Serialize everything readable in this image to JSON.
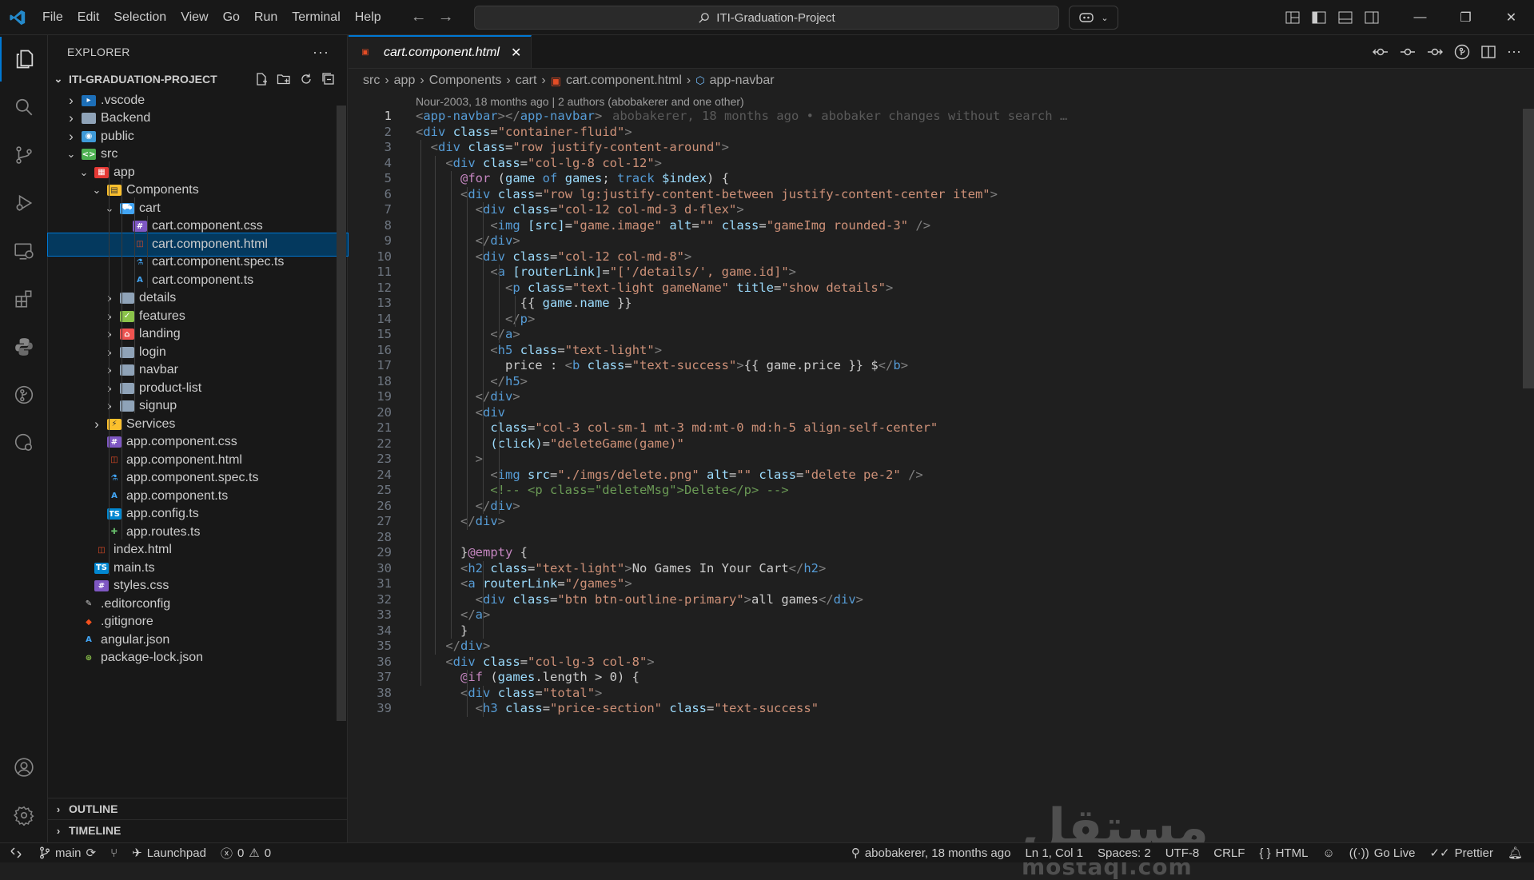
{
  "menu": [
    "File",
    "Edit",
    "Selection",
    "View",
    "Go",
    "Run",
    "Terminal",
    "Help"
  ],
  "command_center": "ITI-Graduation-Project",
  "explorer": {
    "title": "EXPLORER",
    "root": "ITI-GRADUATION-PROJECT",
    "items": [
      {
        "label": ".vscode",
        "icon": "vscode-folder-icon",
        "expanded": false
      },
      {
        "label": "Backend",
        "icon": "folder-icon",
        "expanded": false
      },
      {
        "label": "public",
        "icon": "public-folder-icon",
        "expanded": false
      },
      {
        "label": "src",
        "icon": "src-folder-icon",
        "expanded": true
      },
      {
        "label": "app",
        "icon": "app-folder-icon",
        "expanded": true
      },
      {
        "label": "Components",
        "icon": "components-folder-icon",
        "expanded": true
      },
      {
        "label": "cart",
        "icon": "cart-folder-icon",
        "expanded": true
      },
      {
        "label": "cart.component.css",
        "icon": "css-file-icon"
      },
      {
        "label": "cart.component.html",
        "icon": "html-file-icon",
        "selected": true
      },
      {
        "label": "cart.component.spec.ts",
        "icon": "test-file-icon"
      },
      {
        "label": "cart.component.ts",
        "icon": "angular-file-icon"
      },
      {
        "label": "details",
        "icon": "folder-icon",
        "expanded": false
      },
      {
        "label": "features",
        "icon": "features-folder-icon",
        "expanded": false
      },
      {
        "label": "landing",
        "icon": "landing-folder-icon",
        "expanded": false
      },
      {
        "label": "login",
        "icon": "folder-icon",
        "expanded": false
      },
      {
        "label": "navbar",
        "icon": "folder-icon",
        "expanded": false
      },
      {
        "label": "product-list",
        "icon": "folder-icon",
        "expanded": false
      },
      {
        "label": "signup",
        "icon": "folder-icon",
        "expanded": false
      },
      {
        "label": "Services",
        "icon": "services-folder-icon",
        "expanded": false
      },
      {
        "label": "app.component.css",
        "icon": "css-file-icon"
      },
      {
        "label": "app.component.html",
        "icon": "html-file-icon"
      },
      {
        "label": "app.component.spec.ts",
        "icon": "test-file-icon"
      },
      {
        "label": "app.component.ts",
        "icon": "angular-file-icon"
      },
      {
        "label": "app.config.ts",
        "icon": "ts-file-icon"
      },
      {
        "label": "app.routes.ts",
        "icon": "routes-file-icon"
      },
      {
        "label": "index.html",
        "icon": "html-file-icon"
      },
      {
        "label": "main.ts",
        "icon": "ts-file-icon"
      },
      {
        "label": "styles.css",
        "icon": "css-file-icon"
      },
      {
        "label": ".editorconfig",
        "icon": "editorconfig-icon"
      },
      {
        "label": ".gitignore",
        "icon": "git-icon"
      },
      {
        "label": "angular.json",
        "icon": "angular-file-icon"
      },
      {
        "label": "package-lock.json",
        "icon": "npm-file-icon"
      }
    ],
    "outline": "OUTLINE",
    "timeline": "TIMELINE"
  },
  "tab": {
    "label": "cart.component.html"
  },
  "breadcrumb": [
    "src",
    "app",
    "Components",
    "cart",
    "cart.component.html",
    "app-navbar"
  ],
  "blame_header": "Nour-2003, 18 months ago | 2 authors (abobakerer and one other)",
  "inline_blame": "abobakerer, 18 months ago • abobaker changes without search …",
  "code_lines": [
    "<app-navbar></app-navbar>",
    "<div class=\"container-fluid\">",
    "  <div class=\"row justify-content-around\">",
    "    <div class=\"col-lg-8 col-12\">",
    "      @for (game of games; track $index) {",
    "      <div class=\"row lg:justify-content-between justify-content-center item\">",
    "        <div class=\"col-12 col-md-3 d-flex\">",
    "          <img [src]=\"game.image\" alt=\"\" class=\"gameImg rounded-3\" />",
    "        </div>",
    "        <div class=\"col-12 col-md-8\">",
    "          <a [routerLink]=\"['/details/', game.id]\">",
    "            <p class=\"text-light gameName\" title=\"show details\">",
    "              {{ game.name }}",
    "            </p>",
    "          </a>",
    "          <h5 class=\"text-light\">",
    "            price : <b class=\"text-success\">{{ game.price }} $</b>",
    "          </h5>",
    "        </div>",
    "        <div",
    "          class=\"col-3 col-sm-1 mt-3 md:mt-0 md:h-5 align-self-center\"",
    "          (click)=\"deleteGame(game)\"",
    "        >",
    "          <img src=\"./imgs/delete.png\" alt=\"\" class=\"delete pe-2\" />",
    "          <!-- <p class=\"deleteMsg\">Delete</p> -->",
    "        </div>",
    "      </div>",
    "",
    "      }@empty {",
    "      <h2 class=\"text-light\">No Games In Your Cart</h2>",
    "      <a routerLink=\"/games\">",
    "        <div class=\"btn btn-outline-primary\">all games</div>",
    "      </a>",
    "      }",
    "    </div>",
    "    <div class=\"col-lg-3 col-8\">",
    "      @if (games.length > 0) {",
    "      <div class=\"total\">",
    "        <h3 class=\"price-section\" class=\"text-success\""
  ],
  "watermark": {
    "arabic": "مستقل",
    "latin": "mostaql.com"
  },
  "status": {
    "branch": "main",
    "launchpad": "Launchpad",
    "errors": "0",
    "warnings": "0",
    "blame": "abobakerer, 18 months ago",
    "position": "Ln 1, Col 1",
    "spaces": "Spaces: 2",
    "encoding": "UTF-8",
    "eol": "CRLF",
    "language": "HTML",
    "golive": "Go Live",
    "prettier": "Prettier"
  },
  "colors": {
    "accent": "#0078d4",
    "background": "#1f1f1f",
    "sidebar": "#181818",
    "selection": "#04395e"
  }
}
